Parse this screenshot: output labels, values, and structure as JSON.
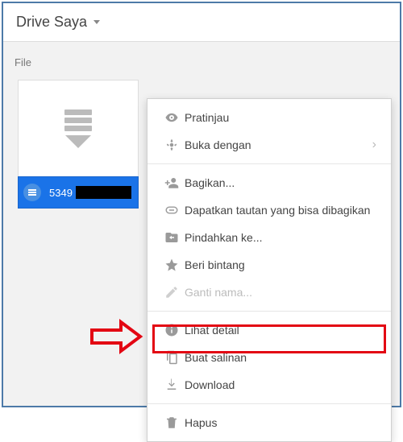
{
  "topbar": {
    "title": "Drive Saya"
  },
  "section_label": "File",
  "file": {
    "id_text": "5349"
  },
  "menu": {
    "preview": "Pratinjau",
    "open_with": "Buka dengan",
    "share": "Bagikan...",
    "get_link": "Dapatkan tautan yang bisa dibagikan",
    "move_to": "Pindahkan ke...",
    "star": "Beri bintang",
    "rename": "Ganti nama...",
    "details": "Lihat detail",
    "make_copy": "Buat salinan",
    "download": "Download",
    "remove": "Hapus"
  }
}
